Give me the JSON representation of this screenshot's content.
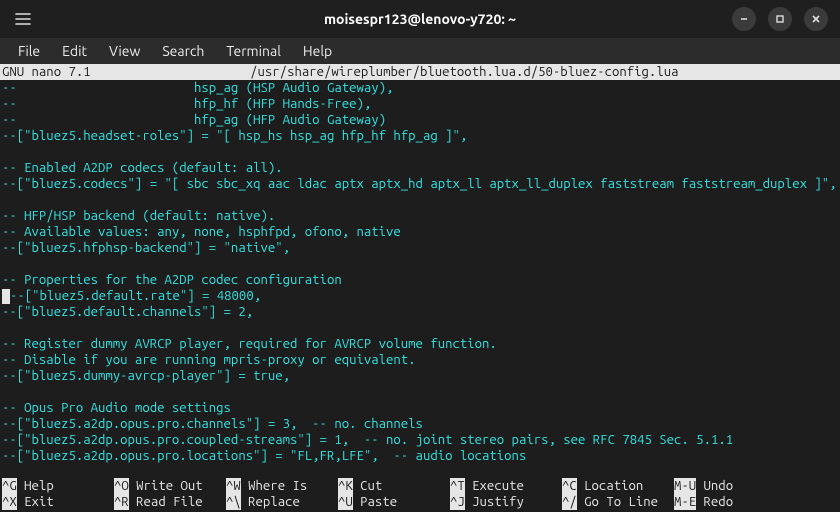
{
  "window": {
    "title": "moisespr123@lenovo-y720: ~"
  },
  "menubar": {
    "items": [
      "File",
      "Edit",
      "View",
      "Search",
      "Terminal",
      "Help"
    ]
  },
  "nano": {
    "version": "GNU nano 7.1",
    "filepath": "/usr/share/wireplumber/bluetooth.lua.d/50-bluez-config.lua",
    "lines": [
      "--                        hsp_ag (HSP Audio Gateway),",
      "--                        hfp_hf (HFP Hands-Free),",
      "--                        hfp_ag (HFP Audio Gateway)",
      "--[\"bluez5.headset-roles\"] = \"[ hsp_hs hsp_ag hfp_hf hfp_ag ]\",",
      "",
      "-- Enabled A2DP codecs (default: all).",
      "--[\"bluez5.codecs\"] = \"[ sbc sbc_xq aac ldac aptx aptx_hd aptx_ll aptx_ll_duplex faststream faststream_duplex ]\",",
      "",
      "-- HFP/HSP backend (default: native).",
      "-- Available values: any, none, hsphfpd, ofono, native",
      "--[\"bluez5.hfphsp-backend\"] = \"native\",",
      "",
      "-- Properties for the A2DP codec configuration",
      "--[\"bluez5.default.rate\"] = 48000,",
      "--[\"bluez5.default.channels\"] = 2,",
      "",
      "-- Register dummy AVRCP player, required for AVRCP volume function.",
      "-- Disable if you are running mpris-proxy or equivalent.",
      "--[\"bluez5.dummy-avrcp-player\"] = true,",
      "",
      "-- Opus Pro Audio mode settings",
      "--[\"bluez5.a2dp.opus.pro.channels\"] = 3,  -- no. channels",
      "--[\"bluez5.a2dp.opus.pro.coupled-streams\"] = 1,  -- no. joint stereo pairs, see RFC 7845 Sec. 5.1.1",
      "--[\"bluez5.a2dp.opus.pro.locations\"] = \"FL,FR,LFE\",  -- audio locations"
    ],
    "cursor_line_index": 13,
    "shortcuts_row1": [
      {
        "key": "^G",
        "label": "Help"
      },
      {
        "key": "^O",
        "label": "Write Out"
      },
      {
        "key": "^W",
        "label": "Where Is"
      },
      {
        "key": "^K",
        "label": "Cut"
      },
      {
        "key": "^T",
        "label": "Execute"
      },
      {
        "key": "^C",
        "label": "Location"
      },
      {
        "key": "M-U",
        "label": "Undo"
      }
    ],
    "shortcuts_row2": [
      {
        "key": "^X",
        "label": "Exit"
      },
      {
        "key": "^R",
        "label": "Read File"
      },
      {
        "key": "^\\",
        "label": "Replace"
      },
      {
        "key": "^U",
        "label": "Paste"
      },
      {
        "key": "^J",
        "label": "Justify"
      },
      {
        "key": "^/",
        "label": "Go To Line"
      },
      {
        "key": "M-E",
        "label": "Redo"
      }
    ]
  },
  "icons": {
    "hamburger": "hamburger-icon",
    "minimize": "minimize-icon",
    "maximize": "maximize-icon",
    "close": "close-icon"
  }
}
